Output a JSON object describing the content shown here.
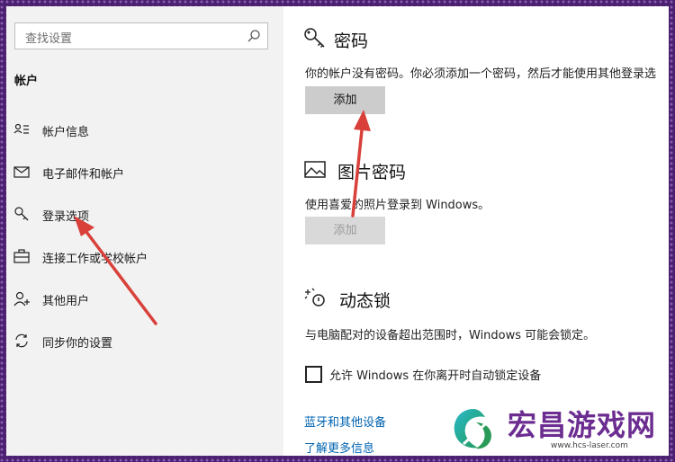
{
  "sidebar": {
    "search": {
      "placeholder": "查找设置",
      "icon": "search-icon"
    },
    "section_title": "帐户",
    "items": [
      {
        "label": "帐户信息",
        "icon": "person-list-icon"
      },
      {
        "label": "电子邮件和帐户",
        "icon": "mail-icon"
      },
      {
        "label": "登录选项",
        "icon": "key-icon"
      },
      {
        "label": "连接工作或学校帐户",
        "icon": "briefcase-icon"
      },
      {
        "label": "其他用户",
        "icon": "person-add-icon"
      },
      {
        "label": "同步你的设置",
        "icon": "sync-icon"
      }
    ]
  },
  "main": {
    "password": {
      "title": "密码",
      "description": "你的帐户没有密码。你必须添加一个密码，然后才能使用其他登录选",
      "button": "添加"
    },
    "picture_password": {
      "title": "图片密码",
      "description": "使用喜爱的照片登录到 Windows。",
      "button": "添加"
    },
    "dynamic_lock": {
      "title": "动态锁",
      "description": "与电脑配对的设备超出范围时，Windows 可能会锁定。",
      "checkbox_label": "允许 Windows 在你离开时自动锁定设备",
      "checked": false
    },
    "links": {
      "bluetooth": "蓝牙和其他设备",
      "learn_more": "了解更多信息"
    }
  },
  "watermark": {
    "title": "宏昌游戏网",
    "url": "www.hcs-laser.com"
  },
  "colors": {
    "annotation_arrow": "#d9403a",
    "link": "#0063b1",
    "frame": "#4b2070",
    "watermark_text": "#6c2d91"
  }
}
